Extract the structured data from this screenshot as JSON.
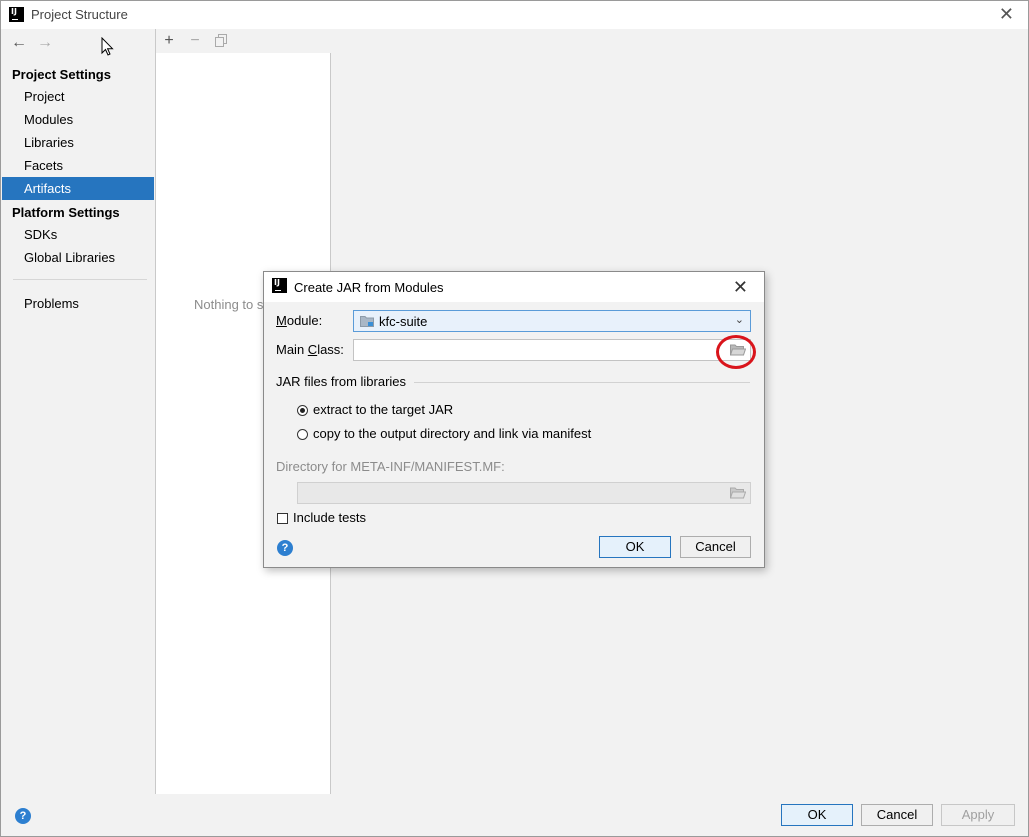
{
  "window": {
    "title": "Project Structure"
  },
  "sidebar": {
    "project_settings_header": "Project Settings",
    "platform_settings_header": "Platform Settings",
    "items": [
      {
        "label": "Project"
      },
      {
        "label": "Modules"
      },
      {
        "label": "Libraries"
      },
      {
        "label": "Facets"
      },
      {
        "label": "Artifacts",
        "selected": true
      }
    ],
    "platform_items": [
      {
        "label": "SDKs"
      },
      {
        "label": "Global Libraries"
      }
    ],
    "problems_label": "Problems"
  },
  "middle": {
    "empty_text": "Nothing to s"
  },
  "bottom": {
    "ok_label": "OK",
    "cancel_label": "Cancel",
    "apply_label": "Apply"
  },
  "dialog": {
    "title": "Create JAR from Modules",
    "module_label": "Module:",
    "module_value": "kfc-suite",
    "main_class_label": "Main Class:",
    "main_class_value": "",
    "jar_group_title": "JAR files from libraries",
    "radio_extract": "extract to the target JAR",
    "radio_copy": "copy to the output directory and link via manifest",
    "manifest_label": "Directory for META-INF/MANIFEST.MF:",
    "manifest_value": "",
    "include_tests": "Include tests",
    "ok_label": "OK",
    "cancel_label": "Cancel"
  },
  "colors": {
    "selection": "#2675bf",
    "highlight_circle": "#d9141b",
    "help": "#2d7fd0"
  }
}
